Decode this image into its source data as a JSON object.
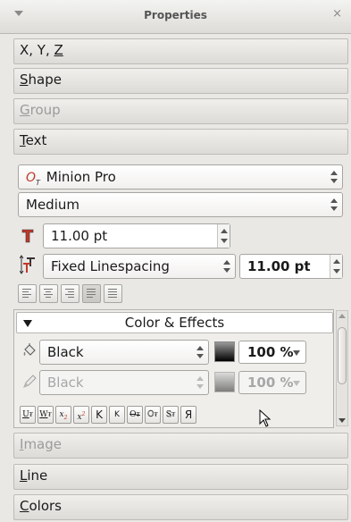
{
  "window": {
    "title": "Properties",
    "close_glyph": "×"
  },
  "sections": {
    "xyz": {
      "label_a": "X, Y, ",
      "label_b": "Z"
    },
    "shape": {
      "mnemonic": "S",
      "rest": "hape"
    },
    "group": {
      "mnemonic": "G",
      "rest": "roup"
    },
    "text": {
      "mnemonic": "T",
      "rest": "ext"
    },
    "image": {
      "mnemonic": "I",
      "rest": "mage"
    },
    "line": {
      "mnemonic": "L",
      "rest": "ine"
    },
    "colors": {
      "mnemonic": "C",
      "rest": "olors"
    }
  },
  "text_panel": {
    "font_family": "Minion Pro",
    "font_style": "Medium",
    "font_size": "11.00 pt",
    "line_spacing_mode": "Fixed Linespacing",
    "line_spacing_value": "11.00 pt",
    "alignment_options": [
      "align-left",
      "align-center",
      "align-right",
      "align-justify",
      "align-forced"
    ],
    "active_alignment_index": 3
  },
  "effects": {
    "header": "Color & Effects",
    "text_color": "Black",
    "text_shade": "100 %",
    "stroke_color": "Black",
    "stroke_shade": "100 %",
    "style_buttons": [
      "U",
      "W",
      "x",
      "x",
      "K",
      "K",
      "O",
      "O",
      "S",
      "Я"
    ]
  },
  "colors": {
    "accent_red": "#c0392b",
    "swatch_black": "#000000"
  }
}
